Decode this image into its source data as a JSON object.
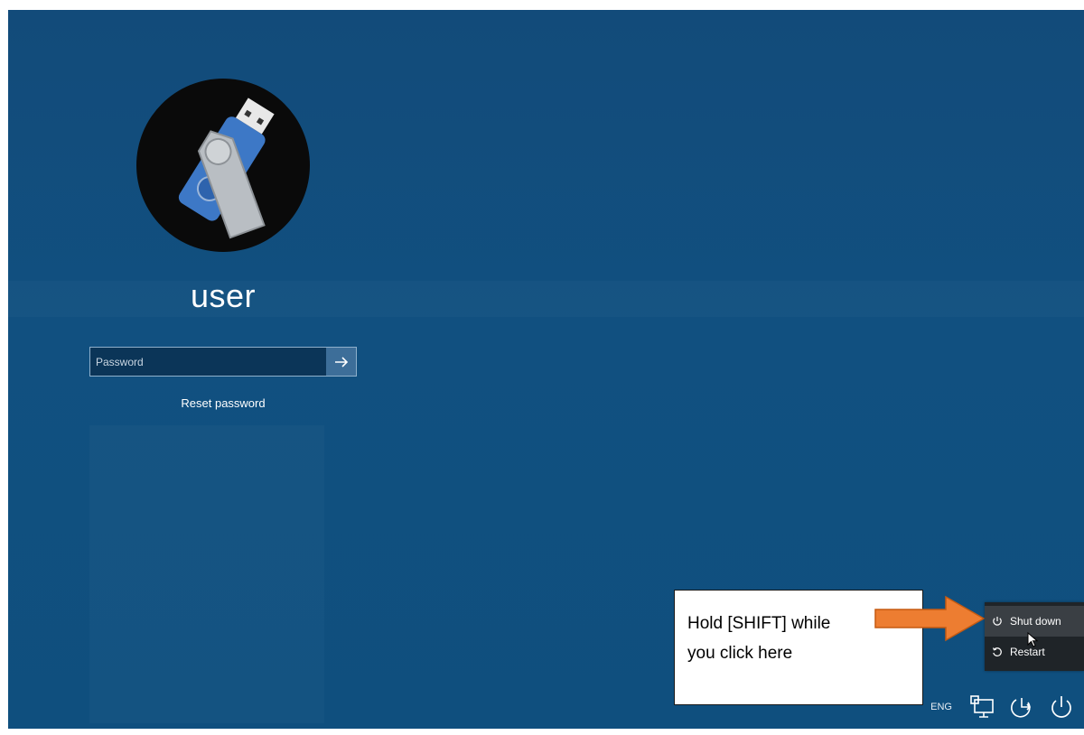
{
  "user": {
    "name": "user"
  },
  "login": {
    "password_placeholder": "Password",
    "reset_link": "Reset password"
  },
  "callout": {
    "line1": "Hold [SHIFT] while",
    "line2": "you click here"
  },
  "power_menu": {
    "shutdown_label": "Shut down",
    "restart_label": "Restart"
  },
  "taskbar": {
    "language": "ENG"
  },
  "icons": {
    "submit": "arrow-right-icon",
    "shutdown": "power-icon",
    "restart": "restart-icon",
    "network": "network-icon",
    "ease_of_access": "ease-of-access-icon",
    "power": "power-icon"
  },
  "colors": {
    "background": "#115080",
    "callout_arrow": "#ed7d31",
    "menu_bg": "#1f2428"
  }
}
